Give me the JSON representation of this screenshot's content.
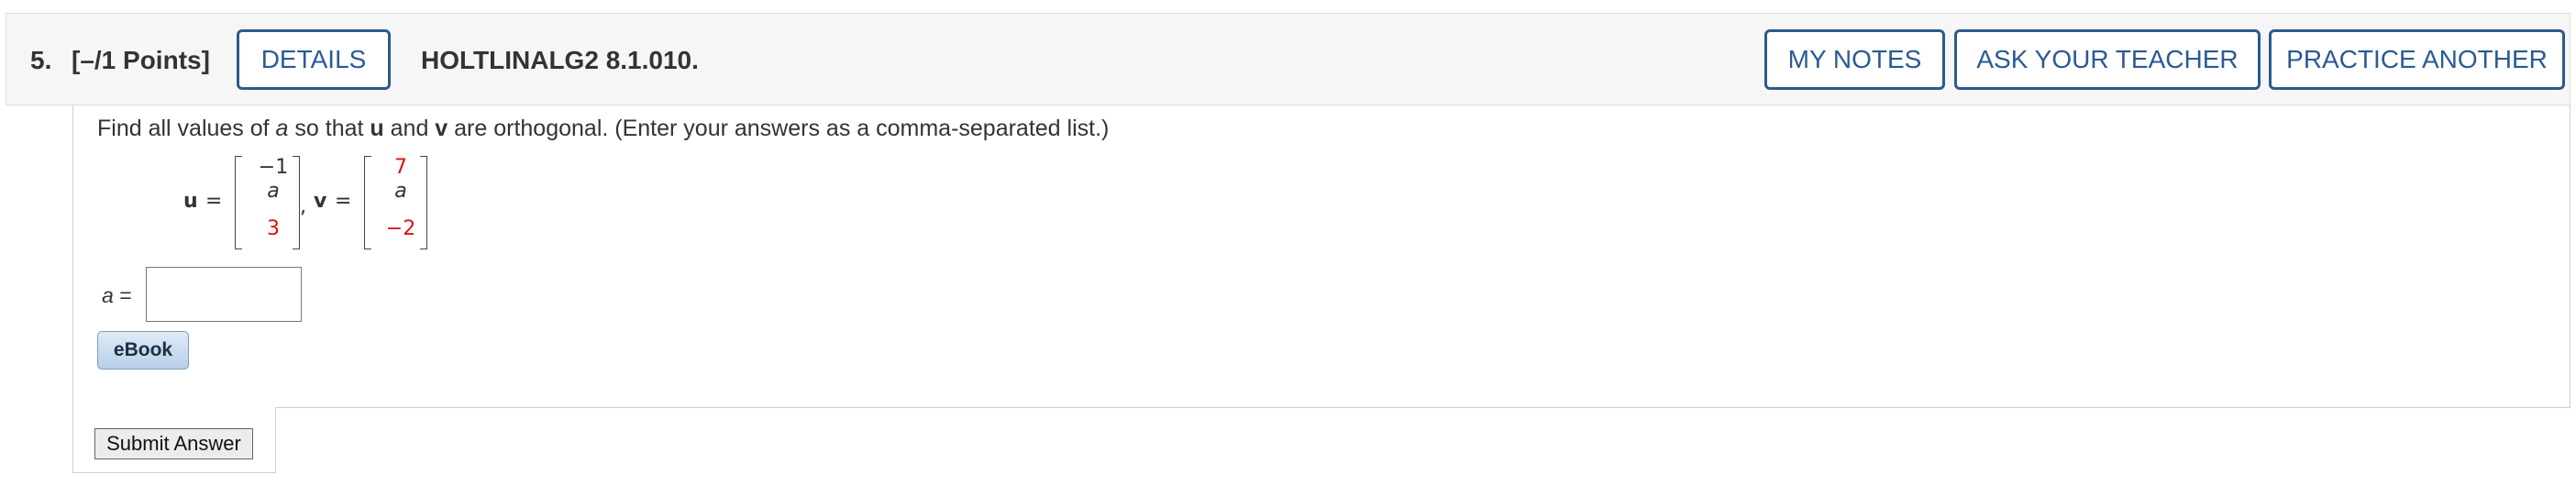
{
  "header": {
    "question_number": "5.",
    "points": "[–/1 Points]",
    "details_label": "DETAILS",
    "question_code": "HOLTLINALG2 8.1.010.",
    "my_notes_label": "MY NOTES",
    "ask_teacher_label": "ASK YOUR TEACHER",
    "practice_another_label": "PRACTICE ANOTHER"
  },
  "question": {
    "prompt_part1": "Find all values of ",
    "prompt_var_a": "a",
    "prompt_part2": " so that ",
    "prompt_vec_u": "u",
    "prompt_part3": " and ",
    "prompt_vec_v": "v",
    "prompt_part4": " are orthogonal. (Enter your answers as a comma-separated list.)",
    "u_label": "u",
    "v_label": "v",
    "equals": "=",
    "comma": ",",
    "u_entries": [
      "−1",
      "a",
      "3"
    ],
    "v_entries": [
      "7",
      "a",
      "−2"
    ]
  },
  "answer": {
    "label_var": "a",
    "label_equals": "=",
    "value": "",
    "placeholder": ""
  },
  "ebook_label": "eBook",
  "submit_label": "Submit Answer",
  "colors": {
    "button_text": "#2a5a94",
    "button_border": "#2c5a8c",
    "highlight_red": "#dd1111"
  }
}
